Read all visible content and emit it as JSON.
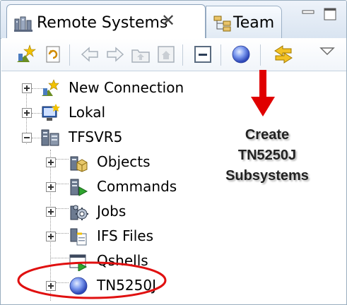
{
  "tabs": [
    {
      "label": "Remote Systems",
      "icon": "remote-systems-icon",
      "active": true,
      "close": "✕"
    },
    {
      "label": "Team",
      "icon": "team-icon",
      "active": false
    }
  ],
  "toolbar": {
    "buttons": [
      "new-connection-icon",
      "refresh-icon",
      "back-arrow-icon",
      "forward-arrow-icon",
      "up-folder-icon",
      "home-icon",
      "collapse-all-icon",
      "create-subsystem-icon",
      "link-with-editor-icon",
      "view-menu-icon"
    ]
  },
  "tree": {
    "items": [
      {
        "label": "New Connection",
        "icon": "new-connection-icon",
        "expanded": false
      },
      {
        "label": "Lokal",
        "icon": "local-icon",
        "expanded": false
      },
      {
        "label": "TFSVR5",
        "icon": "host-icon",
        "expanded": true
      },
      {
        "label": "Objects",
        "icon": "objects-icon",
        "expanded": false
      },
      {
        "label": "Commands",
        "icon": "commands-icon",
        "expanded": false
      },
      {
        "label": "Jobs",
        "icon": "jobs-icon",
        "expanded": false
      },
      {
        "label": "IFS Files",
        "icon": "ifs-files-icon",
        "expanded": false
      },
      {
        "label": "Qshells",
        "icon": "qshells-icon",
        "expanded": false
      },
      {
        "label": "TN5250J",
        "icon": "tn5250j-icon",
        "expanded": false
      }
    ]
  },
  "annotation": {
    "lines": [
      "Create",
      "TN5250J",
      "Subsystems"
    ],
    "arrow_color": "#e00000",
    "ellipse_color": "#e01010"
  }
}
